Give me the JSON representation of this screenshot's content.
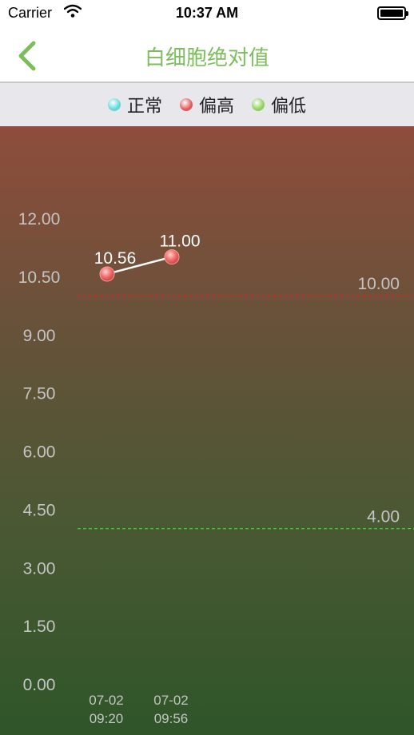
{
  "status_bar": {
    "carrier": "Carrier",
    "time": "10:37 AM"
  },
  "nav": {
    "title": "白细胞绝对值",
    "back_icon": "chevron-left-icon"
  },
  "legend": [
    {
      "label": "正常",
      "color": "#5fd8d8"
    },
    {
      "label": "偏高",
      "color": "#e05858"
    },
    {
      "label": "偏低",
      "color": "#8fd05a"
    }
  ],
  "colors": {
    "accent": "#7dbd5c",
    "upper_line": "#e02020",
    "lower_line": "#30d030"
  },
  "chart_data": {
    "type": "line",
    "title": "",
    "y_ticks": [
      "12.00",
      "10.50",
      "9.00",
      "7.50",
      "6.00",
      "4.50",
      "3.00",
      "1.50",
      "0.00"
    ],
    "ylim": [
      0,
      12
    ],
    "x": [
      [
        "07-02",
        "09:20"
      ],
      [
        "07-02",
        "09:56"
      ]
    ],
    "values": [
      10.56,
      11.0
    ],
    "value_labels": [
      "10.56",
      "11.00"
    ],
    "reference_lines": [
      {
        "value": 10.0,
        "label": "10.00",
        "color": "#e02020"
      },
      {
        "value": 4.0,
        "label": "4.00",
        "color": "#30d030"
      }
    ],
    "grid": false
  }
}
